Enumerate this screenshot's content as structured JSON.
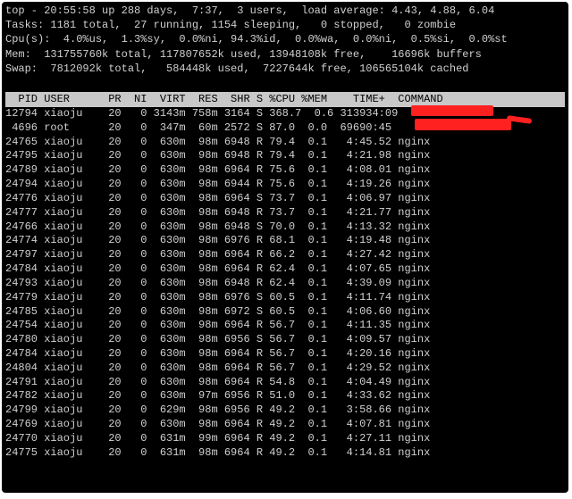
{
  "summary": {
    "line1": "top - 20:55:58 up 288 days,  7:37,  3 users,  load average: 4.43, 4.88, 6.04",
    "line2": "Tasks: 1181 total,  27 running, 1154 sleeping,   0 stopped,   0 zombie",
    "line3": "Cpu(s):  4.0%us,  1.3%sy,  0.0%ni, 94.3%id,  0.0%wa,  0.0%ni,  0.5%si,  0.0%st",
    "line4": "Mem:  131755760k total, 117807652k used, 13948108k free,    16696k buffers",
    "line5": "Swap:  7812092k total,   584448k used,  7227644k free, 106565104k cached"
  },
  "header": "  PID USER      PR  NI  VIRT  RES  SHR S %CPU %MEM    TIME+  COMMAND",
  "rows": [
    {
      "text": "12794 xiaoju    20   0 3143m 758m 3164 S 368.7  0.6 313934:09 "
    },
    {
      "text": " 4696 root      20   0  347m  60m 2572 S 87.0  0.0  69690:45 "
    },
    {
      "text": "24765 xiaoju    20   0  630m  98m 6948 R 79.4  0.1   4:45.52 nginx"
    },
    {
      "text": "24795 xiaoju    20   0  630m  98m 6948 R 79.4  0.1   4:21.98 nginx"
    },
    {
      "text": "24789 xiaoju    20   0  630m  98m 6964 R 75.6  0.1   4:08.01 nginx"
    },
    {
      "text": "24794 xiaoju    20   0  630m  98m 6944 R 75.6  0.1   4:19.26 nginx"
    },
    {
      "text": "24776 xiaoju    20   0  630m  98m 6964 S 73.7  0.1   4:06.97 nginx"
    },
    {
      "text": "24777 xiaoju    20   0  630m  98m 6948 R 73.7  0.1   4:21.77 nginx"
    },
    {
      "text": "24766 xiaoju    20   0  630m  98m 6948 S 70.0  0.1   4:13.32 nginx"
    },
    {
      "text": "24774 xiaoju    20   0  630m  98m 6976 R 68.1  0.1   4:19.48 nginx"
    },
    {
      "text": "24797 xiaoju    20   0  630m  98m 6964 R 66.2  0.1   4:27.42 nginx"
    },
    {
      "text": "24784 xiaoju    20   0  630m  98m 6964 R 62.4  0.1   4:07.65 nginx"
    },
    {
      "text": "24793 xiaoju    20   0  630m  98m 6948 R 62.4  0.1   4:39.09 nginx"
    },
    {
      "text": "24779 xiaoju    20   0  630m  98m 6976 S 60.5  0.1   4:11.74 nginx"
    },
    {
      "text": "24785 xiaoju    20   0  630m  98m 6972 S 60.5  0.1   4:06.60 nginx"
    },
    {
      "text": "24754 xiaoju    20   0  630m  98m 6964 R 56.7  0.1   4:11.35 nginx"
    },
    {
      "text": "24780 xiaoju    20   0  630m  98m 6956 S 56.7  0.1   4:09.57 nginx"
    },
    {
      "text": "24784 xiaoju    20   0  630m  98m 6964 R 56.7  0.1   4:20.16 nginx"
    },
    {
      "text": "24804 xiaoju    20   0  630m  98m 6964 R 56.7  0.1   4:29.52 nginx"
    },
    {
      "text": "24791 xiaoju    20   0  630m  98m 6964 R 54.8  0.1   4:04.49 nginx"
    },
    {
      "text": "24782 xiaoju    20   0  630m  97m 6956 R 51.0  0.1   4:33.62 nginx"
    },
    {
      "text": "24799 xiaoju    20   0  629m  98m 6956 R 49.2  0.1   3:58.66 nginx"
    },
    {
      "text": "24769 xiaoju    20   0  630m  98m 6964 R 49.2  0.1   4:07.81 nginx"
    },
    {
      "text": "24770 xiaoju    20   0  631m  99m 6964 R 49.2  0.1   4:27.11 nginx"
    },
    {
      "text": "24775 xiaoju    20   0  631m  98m 6964 R 49.2  0.1   4:14.81 nginx"
    }
  ]
}
